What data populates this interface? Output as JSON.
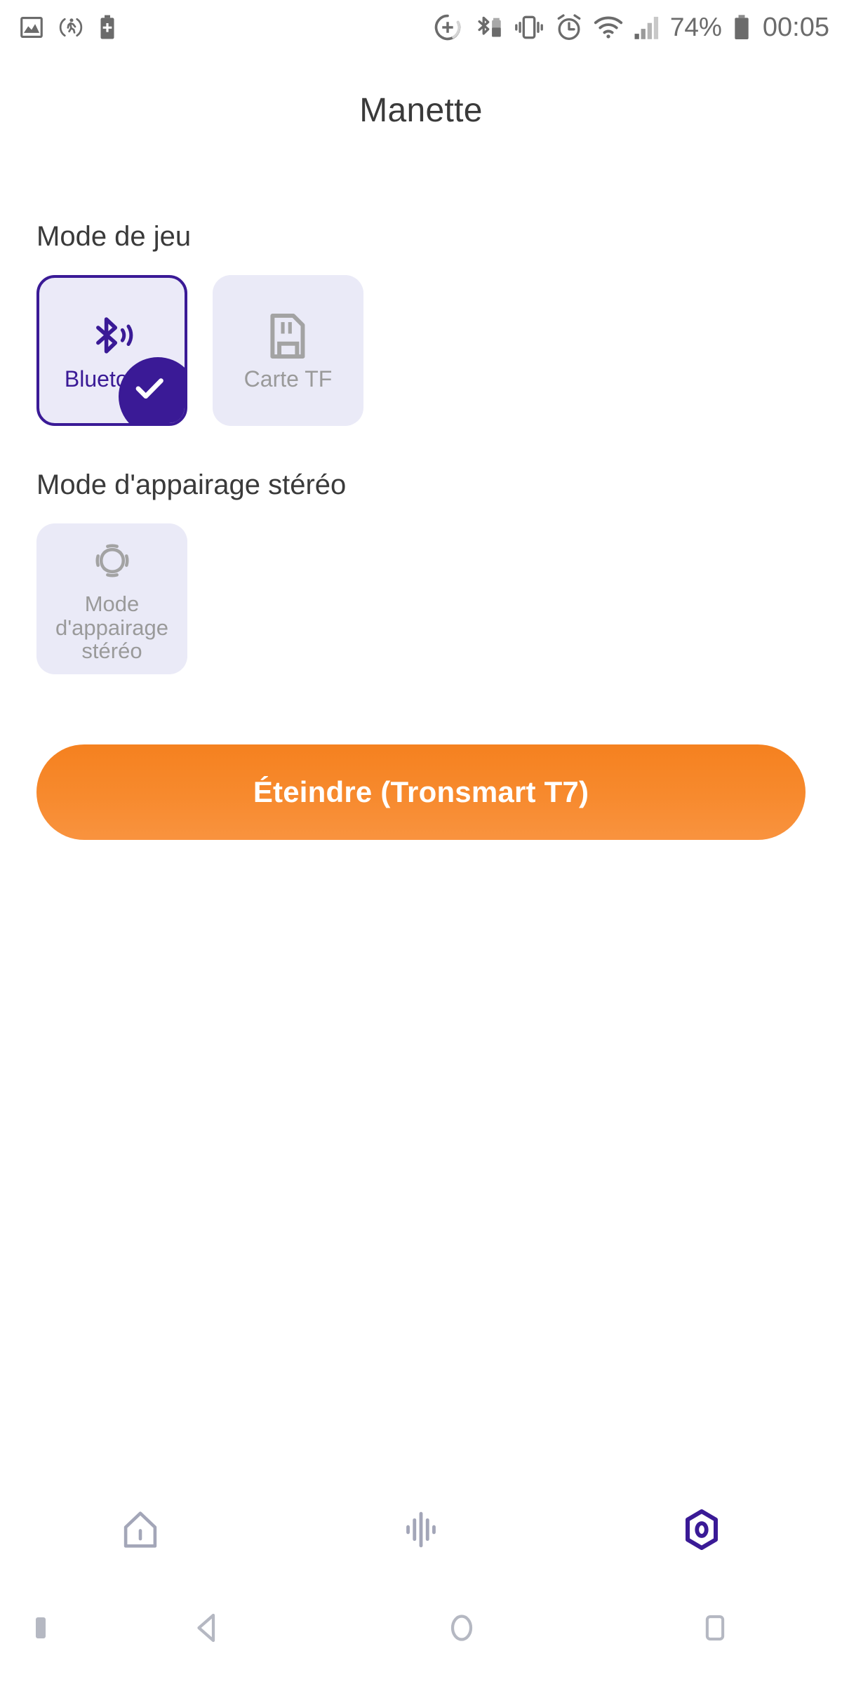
{
  "status_bar": {
    "left_icons": [
      {
        "name": "image-icon",
        "label": "Image"
      },
      {
        "name": "activity-tracker-icon",
        "label": "Activity"
      },
      {
        "name": "battery-plus-icon",
        "label": "Battery saver"
      }
    ],
    "right_icons": [
      {
        "name": "data-saver-icon",
        "label": "Data saver"
      },
      {
        "name": "bluetooth-battery-icon",
        "label": "Bluetooth device battery"
      },
      {
        "name": "vibrate-icon",
        "label": "Vibrate"
      },
      {
        "name": "alarm-icon",
        "label": "Alarm"
      },
      {
        "name": "wifi-icon",
        "label": "Wi-Fi"
      },
      {
        "name": "signal-icon",
        "label": "Cellular signal"
      }
    ],
    "battery_percent": "74%",
    "clock": "00:05"
  },
  "header": {
    "title": "Manette"
  },
  "sections": {
    "game_mode": {
      "label": "Mode de jeu",
      "cards": [
        {
          "id": "bluetooth",
          "label": "Bluetooth",
          "icon": "bluetooth-audio-icon",
          "selected": true
        },
        {
          "id": "tf-card",
          "label": "Carte TF",
          "icon": "sd-card-icon",
          "selected": false
        }
      ]
    },
    "stereo_pairing": {
      "label": "Mode d'appairage stéréo",
      "cards": [
        {
          "id": "stereo-pairing",
          "label": "Mode d'appairage stéréo",
          "icon": "stereo-waves-icon",
          "selected": false
        }
      ]
    }
  },
  "power_button": {
    "label": "Éteindre (Tronsmart T7)"
  },
  "tab_bar": {
    "items": [
      {
        "id": "home",
        "icon": "home-icon",
        "label": "Accueil",
        "active": false
      },
      {
        "id": "equalizer",
        "icon": "equalizer-icon",
        "label": "Égaliseur",
        "active": false
      },
      {
        "id": "controller",
        "icon": "hexagon-controller-icon",
        "label": "Manette",
        "active": true
      }
    ]
  },
  "nav_bar": {
    "items": [
      {
        "id": "indicator",
        "icon": "nav-indicator-dot",
        "label": ""
      },
      {
        "id": "back",
        "icon": "back-triangle-icon",
        "label": "Retour"
      },
      {
        "id": "home",
        "icon": "home-circle-icon",
        "label": "Accueil"
      },
      {
        "id": "recents",
        "icon": "recents-square-icon",
        "label": "Applications récentes"
      }
    ]
  },
  "colors": {
    "accent_purple": "#3A1A96",
    "card_bg": "#EAEAF7",
    "muted_text": "#9A9A9A",
    "title_text": "#3A3A3A",
    "orange_button": "#F5811F",
    "status_gray": "#6B6B6B",
    "nav_gray": "#B5B8C2"
  }
}
